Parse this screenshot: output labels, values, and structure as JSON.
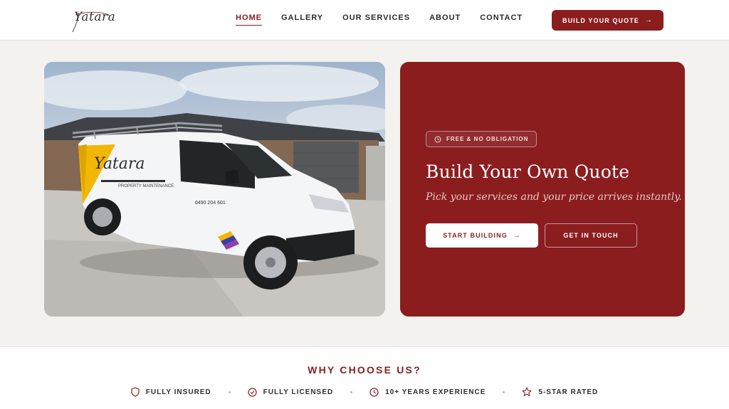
{
  "brand": {
    "logo_text": "Yatara"
  },
  "nav": {
    "items": [
      {
        "label": "HOME",
        "active": true
      },
      {
        "label": "GALLERY",
        "active": false
      },
      {
        "label": "OUR SERVICES",
        "active": false
      },
      {
        "label": "ABOUT",
        "active": false
      },
      {
        "label": "CONTACT",
        "active": false
      }
    ],
    "cta_label": "BUILD YOUR QUOTE"
  },
  "photo": {
    "van_brand": "Yatara",
    "van_tagline": "PROPERTY MAINTENANCE",
    "van_phone": "0490 204 601"
  },
  "hero": {
    "badge": "FREE & NO OBLIGATION",
    "title": "Build Your Own Quote",
    "subtitle": "Pick your services and your price arrives instantly.",
    "primary_button": "START BUILDING",
    "secondary_button": "GET IN TOUCH"
  },
  "why": {
    "title": "WHY CHOOSE US?",
    "features": [
      {
        "label": "FULLY INSURED",
        "icon": "shield-icon"
      },
      {
        "label": "FULLY LICENSED",
        "icon": "check-circle-icon"
      },
      {
        "label": "10+ YEARS EXPERIENCE",
        "icon": "clock-icon"
      },
      {
        "label": "5-STAR RATED",
        "icon": "star-icon"
      }
    ]
  },
  "colors": {
    "accent": "#8b1d1f",
    "background": "#f4f2ef",
    "white": "#ffffff"
  }
}
